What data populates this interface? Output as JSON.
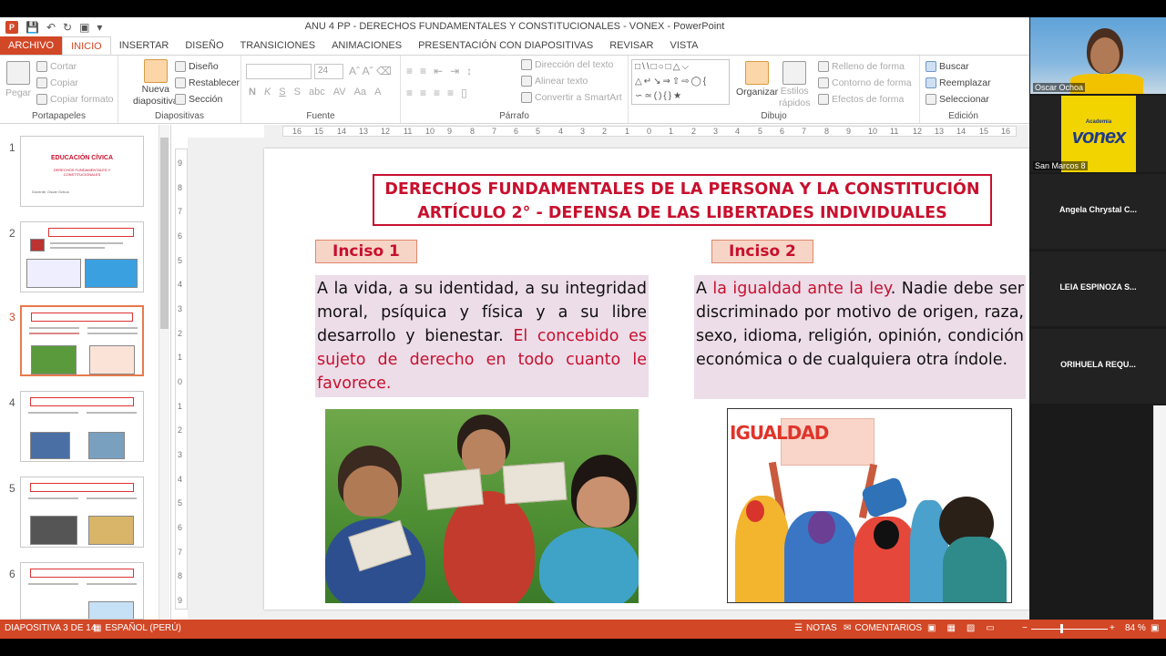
{
  "window": {
    "title": "ANU 4 PP - DERECHOS FUNDAMENTALES Y CONSTITUCIONALES - VONEX - PowerPoint"
  },
  "tabs": [
    "ARCHIVO",
    "INICIO",
    "INSERTAR",
    "DISEÑO",
    "TRANSICIONES",
    "ANIMACIONES",
    "PRESENTACIÓN CON DIAPOSITIVAS",
    "REVISAR",
    "VISTA"
  ],
  "ribbon": {
    "portapapeles": {
      "label": "Portapapeles",
      "pegar": "Pegar",
      "cortar": "Cortar",
      "copiar": "Copiar",
      "copiar_formato": "Copiar formato"
    },
    "diapositivas": {
      "label": "Diapositivas",
      "nueva": "Nueva",
      "nueva2": "diapositiva",
      "diseno": "Diseño",
      "restablecer": "Restablecer",
      "seccion": "Sección"
    },
    "fuente": {
      "label": "Fuente",
      "size": "24"
    },
    "parrafo": {
      "label": "Párrafo",
      "direccion": "Dirección del texto",
      "alinear": "Alinear texto",
      "smartart": "Convertir a SmartArt"
    },
    "dibujo": {
      "label": "Dibujo",
      "organizar": "Organizar",
      "estilos": "Estilos",
      "estilos2": "rápidos",
      "relleno": "Relleno de forma",
      "contorno": "Contorno de forma",
      "efectos": "Efectos de forma"
    },
    "edicion": {
      "label": "Edición",
      "buscar": "Buscar",
      "reemplazar": "Reemplazar",
      "seleccionar": "Seleccionar"
    }
  },
  "ruler": {
    "h_ticks": [
      "16",
      "15",
      "14",
      "13",
      "12",
      "11",
      "10",
      "9",
      "8",
      "7",
      "6",
      "5",
      "4",
      "3",
      "2",
      "1",
      "0",
      "1",
      "2",
      "3",
      "4",
      "5",
      "6",
      "7",
      "8",
      "9",
      "10",
      "11",
      "12",
      "13",
      "14",
      "15",
      "16"
    ],
    "v_ticks": [
      "9",
      "8",
      "7",
      "6",
      "5",
      "4",
      "3",
      "2",
      "1",
      "0",
      "1",
      "2",
      "3",
      "4",
      "5",
      "6",
      "7",
      "8",
      "9"
    ]
  },
  "thumbnails": [
    {
      "num": "1",
      "title": "EDUCACIÓN CÍVICA",
      "sub": "DERECHOS FUNDAMENTALES Y CONSTITUCIONALES",
      "author": "Docente: Oscar Ochoa"
    },
    {
      "num": "2"
    },
    {
      "num": "3"
    },
    {
      "num": "4"
    },
    {
      "num": "5"
    },
    {
      "num": "6"
    }
  ],
  "slide": {
    "title_line1": "DERECHOS FUNDAMENTALES DE LA PERSONA Y LA CONSTITUCIÓN",
    "title_line2": "ARTÍCULO 2° - DEFENSA DE LAS LIBERTADES INDIVIDUALES",
    "inciso1": "Inciso 1",
    "inciso2": "Inciso 2",
    "text1_a": "A la vida, a su identidad, a su integridad moral, psíquica y física y a su libre desarrollo y bienestar. ",
    "text1_b": "El concebido es sujeto de derecho en todo cuanto le favorece.",
    "text2_a": "A ",
    "text2_b": "la igualdad ante la ley",
    "text2_c": ". Nadie debe ser discriminado por motivo de origen, raza, sexo, idioma, religión, opinión, condición económica o de cualquiera otra índole.",
    "sign_text": "IGUALDAD"
  },
  "participants": [
    {
      "name": "Oscar Ochoa",
      "type": "video"
    },
    {
      "name": "San Marcos 8",
      "logo_small": "Academia",
      "logo": "vonex"
    },
    {
      "name": "Angela Chrystal C..."
    },
    {
      "name": "LEIA ESPINOZA S..."
    },
    {
      "name": "ORIHUELA REQU..."
    }
  ],
  "status": {
    "slide": "DIAPOSITIVA 3 DE 14",
    "lang": "ESPAÑOL (PERÚ)",
    "notas": "NOTAS",
    "comentarios": "COMENTARIOS",
    "zoom": "84 %"
  },
  "colors": {
    "accent": "#d24726",
    "title_red": "#c8102e",
    "textbox_bg": "#ecdde9",
    "inciso_bg": "#f6d5c6",
    "vonex_yellow": "#f2d400",
    "vonex_blue": "#1e3a8a"
  }
}
